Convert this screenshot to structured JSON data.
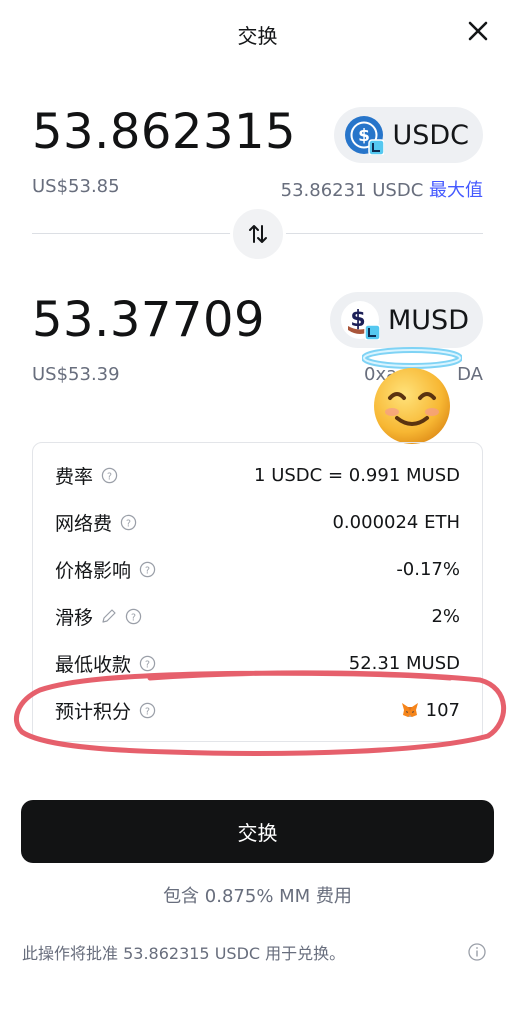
{
  "header": {
    "title": "交换"
  },
  "from": {
    "amount": "53.862315",
    "token_symbol": "USDC",
    "fiat_value": "US$53.85",
    "balance": "53.86231 USDC",
    "max_label": "最大值"
  },
  "to": {
    "amount": "53.37709",
    "token_symbol": "MUSD",
    "fiat_value": "US$53.39",
    "address": "0xa",
    "address_tail": "DA"
  },
  "details": {
    "rate": {
      "label": "费率",
      "value": "1 USDC = 0.991 MUSD"
    },
    "network_fee": {
      "label": "网络费",
      "value": "0.000024 ETH"
    },
    "price_impact": {
      "label": "价格影响",
      "value": "-0.17%"
    },
    "slippage": {
      "label": "滑移",
      "value": "2%"
    },
    "min_received": {
      "label": "最低收款",
      "value": "52.31 MUSD"
    },
    "points": {
      "label": "预计积分",
      "value": "107"
    }
  },
  "swap_button_label": "交换",
  "fee_note": "包含 0.875% MM 费用",
  "approval_note": "此操作将批准 53.862315 USDC 用于兑换。",
  "icons": {
    "close": "close-icon",
    "swap_direction": "swap-arrows-icon",
    "usdc": "usdc-token-icon",
    "musd": "musd-token-icon",
    "help": "question-icon",
    "edit": "pencil-icon",
    "metamask": "metamask-fox-icon",
    "info": "info-icon",
    "emoji": "halo-smile-emoji"
  },
  "colors": {
    "link": "#4459ff",
    "button_bg": "#121314",
    "annotation": "#e4535f",
    "usdc_blue": "#2775ca"
  }
}
